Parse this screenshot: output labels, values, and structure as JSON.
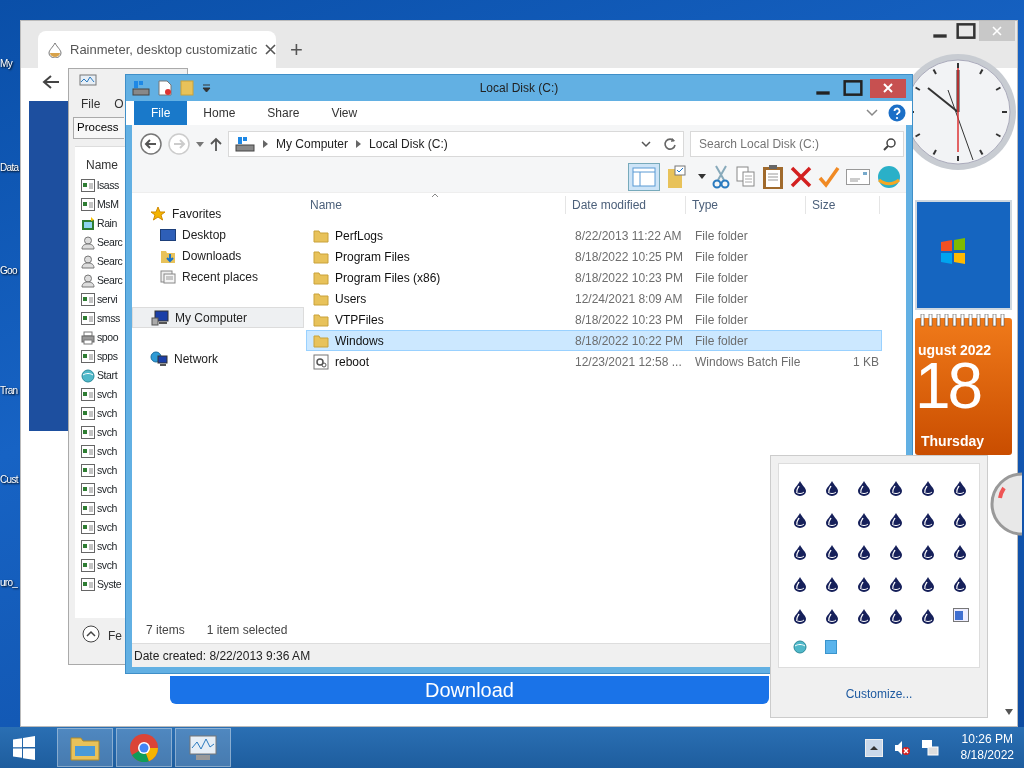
{
  "desktop_icons": [
    {
      "label": "My"
    },
    {
      "label": "Data"
    },
    {
      "label": "Goo"
    },
    {
      "label": "Tran"
    },
    {
      "label": "Cust"
    },
    {
      "label": "uro_"
    }
  ],
  "browser": {
    "tab": {
      "title": "Rainmeter, desktop customizatic",
      "selected": true
    },
    "new_tab": "+",
    "download_button": "Download"
  },
  "task_manager": {
    "menu": [
      "File",
      "O"
    ],
    "tab": "Process",
    "column": "Name",
    "details_toggle": "Fe",
    "processes": [
      {
        "name": "lsass",
        "kind": "window"
      },
      {
        "name": "MsM",
        "kind": "window"
      },
      {
        "name": "Rain",
        "kind": "rainmeter"
      },
      {
        "name": "Searc",
        "kind": "search"
      },
      {
        "name": "Searc",
        "kind": "search"
      },
      {
        "name": "Searc",
        "kind": "search"
      },
      {
        "name": "servi",
        "kind": "window"
      },
      {
        "name": "smss",
        "kind": "window"
      },
      {
        "name": "spoo",
        "kind": "printer"
      },
      {
        "name": "spps",
        "kind": "window"
      },
      {
        "name": "Start",
        "kind": "globe"
      },
      {
        "name": "svch",
        "kind": "window"
      },
      {
        "name": "svch",
        "kind": "window"
      },
      {
        "name": "svch",
        "kind": "window"
      },
      {
        "name": "svch",
        "kind": "window"
      },
      {
        "name": "svch",
        "kind": "window"
      },
      {
        "name": "svch",
        "kind": "window"
      },
      {
        "name": "svch",
        "kind": "window"
      },
      {
        "name": "svch",
        "kind": "window"
      },
      {
        "name": "svch",
        "kind": "window"
      },
      {
        "name": "svch",
        "kind": "window"
      },
      {
        "name": "Syste",
        "kind": "window"
      }
    ]
  },
  "explorer": {
    "title": "Local Disk (C:)",
    "ribbon_tabs": [
      {
        "label": "File",
        "selected": true
      },
      {
        "label": "Home",
        "selected": false
      },
      {
        "label": "Share",
        "selected": false
      },
      {
        "label": "View",
        "selected": false
      }
    ],
    "breadcrumb": [
      "My Computer",
      "Local Disk (C:)"
    ],
    "search": {
      "placeholder": "Search Local Disk (C:)"
    },
    "nav": [
      {
        "label": "Favorites",
        "kind": "star",
        "selected": false,
        "children": [
          {
            "label": "Desktop",
            "kind": "desktop",
            "selected": false
          },
          {
            "label": "Downloads",
            "kind": "downloads",
            "selected": false
          },
          {
            "label": "Recent places",
            "kind": "recent",
            "selected": false
          }
        ]
      },
      {
        "label": "My Computer",
        "kind": "computer",
        "selected": true
      },
      {
        "label": "Network",
        "kind": "network",
        "selected": false
      }
    ],
    "columns": [
      "Name",
      "Date modified",
      "Type",
      "Size"
    ],
    "files": [
      {
        "name": "PerfLogs",
        "date": "8/22/2013 11:22 AM",
        "type": "File folder",
        "kind": "folder",
        "selected": false
      },
      {
        "name": "Program Files",
        "date": "8/18/2022 10:25 PM",
        "type": "File folder",
        "kind": "folder",
        "selected": false
      },
      {
        "name": "Program Files (x86)",
        "date": "8/18/2022 10:23 PM",
        "type": "File folder",
        "kind": "folder",
        "selected": false
      },
      {
        "name": "Users",
        "date": "12/24/2021 8:09 AM",
        "type": "File folder",
        "kind": "folder",
        "selected": false
      },
      {
        "name": "VTPFiles",
        "date": "8/18/2022 10:23 PM",
        "type": "File folder",
        "kind": "folder",
        "selected": false
      },
      {
        "name": "Windows",
        "date": "8/18/2022 10:22 PM",
        "type": "File folder",
        "kind": "folder",
        "selected": true
      },
      {
        "name": "reboot",
        "date": "12/23/2021 12:58 ...",
        "type": "Windows Batch File",
        "size": "1 KB",
        "kind": "batch",
        "selected": false
      }
    ],
    "status": {
      "items": "7 items",
      "selection": "1 item selected"
    },
    "details": "Date created: 8/22/2013 9:36 AM"
  },
  "calendar": {
    "month": "ugust 2022",
    "day": "18",
    "weekday": "Thursday"
  },
  "tray_overflow": {
    "icons": [
      {
        "kind": "drop"
      },
      {
        "kind": "drop"
      },
      {
        "kind": "drop"
      },
      {
        "kind": "drop"
      },
      {
        "kind": "drop"
      },
      {
        "kind": "drop"
      },
      {
        "kind": "drop"
      },
      {
        "kind": "drop"
      },
      {
        "kind": "drop"
      },
      {
        "kind": "drop"
      },
      {
        "kind": "drop"
      },
      {
        "kind": "drop"
      },
      {
        "kind": "drop"
      },
      {
        "kind": "drop"
      },
      {
        "kind": "drop"
      },
      {
        "kind": "drop"
      },
      {
        "kind": "drop"
      },
      {
        "kind": "drop"
      },
      {
        "kind": "drop"
      },
      {
        "kind": "drop"
      },
      {
        "kind": "drop"
      },
      {
        "kind": "drop"
      },
      {
        "kind": "drop"
      },
      {
        "kind": "drop"
      },
      {
        "kind": "drop"
      },
      {
        "kind": "drop"
      },
      {
        "kind": "drop"
      },
      {
        "kind": "drop"
      },
      {
        "kind": "drop"
      },
      {
        "kind": "window"
      },
      {
        "kind": "globe"
      },
      {
        "kind": "square"
      }
    ],
    "customize": "Customize..."
  },
  "taskbar": {
    "apps": [
      {
        "kind": "explorer"
      },
      {
        "kind": "chrome"
      },
      {
        "kind": "monitor"
      }
    ],
    "tray": {
      "muted": true
    },
    "time": "10:26 PM",
    "date": "8/18/2022"
  }
}
